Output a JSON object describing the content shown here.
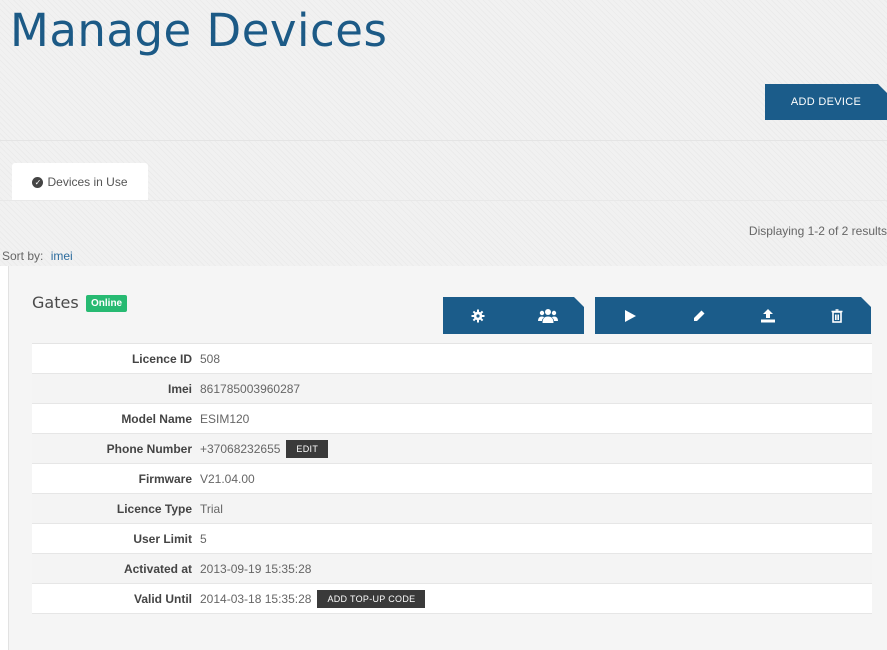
{
  "header": {
    "title": "Manage Devices",
    "add_device_label": "ADD DEVICE"
  },
  "tabs": [
    {
      "label": "Devices in Use",
      "icon": "check-circle-icon"
    }
  ],
  "results": {
    "text": "Displaying 1-2 of 2 results"
  },
  "sort": {
    "label": "Sort by:",
    "value": "imei"
  },
  "device": {
    "name": "Gates",
    "status": "Online",
    "status_color": "#27ba72",
    "actions": [
      {
        "icon": "gear-icon"
      },
      {
        "icon": "users-icon"
      },
      {
        "icon": "play-icon"
      },
      {
        "icon": "pencil-icon"
      },
      {
        "icon": "upload-icon"
      },
      {
        "icon": "trash-icon"
      }
    ],
    "fields": [
      {
        "label": "Licence ID",
        "value": "508"
      },
      {
        "label": "Imei",
        "value": "861785003960287"
      },
      {
        "label": "Model Name",
        "value": "ESIM120"
      },
      {
        "label": "Phone Number",
        "value": "+37068232655",
        "button": "EDIT"
      },
      {
        "label": "Firmware",
        "value": "V21.04.00"
      },
      {
        "label": "Licence Type",
        "value": "Trial"
      },
      {
        "label": "User Limit",
        "value": "5"
      },
      {
        "label": "Activated at",
        "value": "2013-09-19 15:35:28"
      },
      {
        "label": "Valid Until",
        "value": "2014-03-18 15:35:28",
        "button": "ADD TOP-UP CODE"
      }
    ]
  },
  "colors": {
    "title": "#1c5a86",
    "primary_button": "#1b5c8a",
    "dark_button": "#3a3a3a"
  }
}
